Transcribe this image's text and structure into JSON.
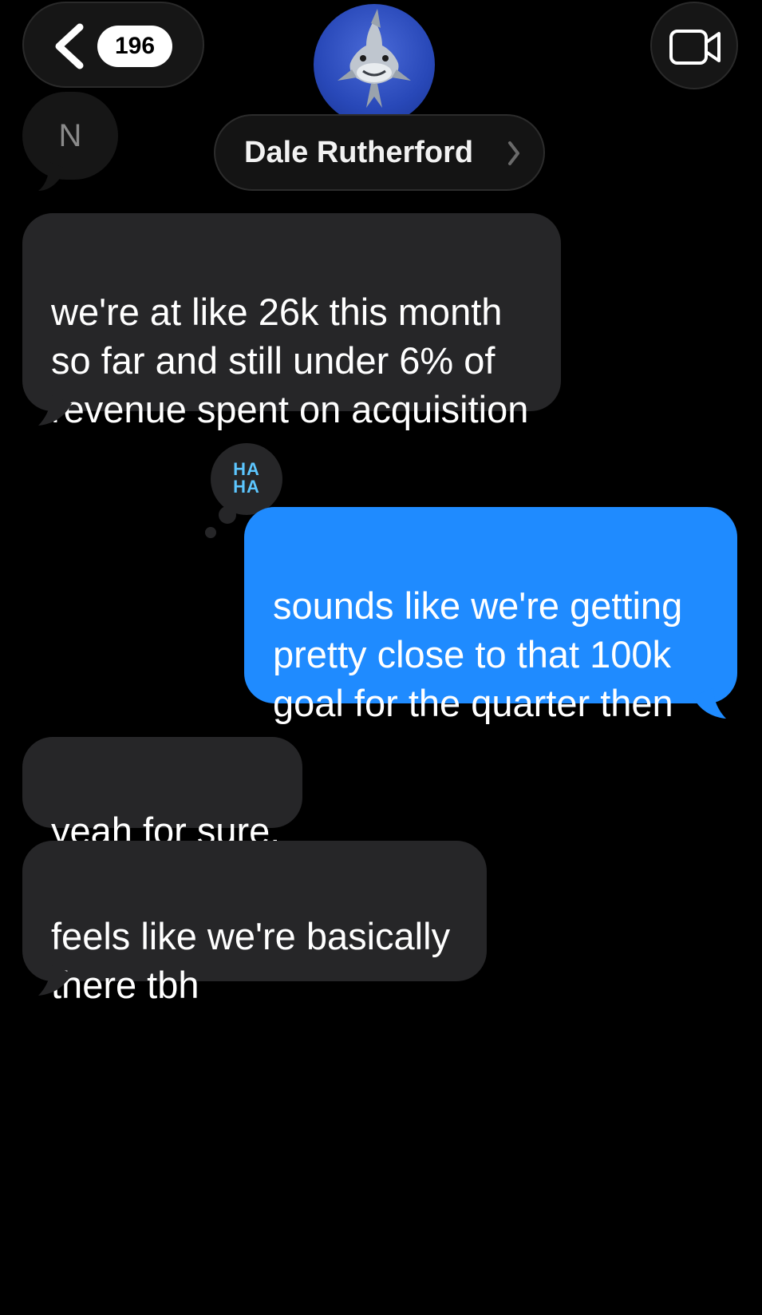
{
  "header": {
    "back_count": "196",
    "contact_name": "Dale Rutherford",
    "initial": "N",
    "avatar_icon": "shark-memoji-icon",
    "video_icon": "video-camera-icon"
  },
  "messages": [
    {
      "direction": "received",
      "text": "we're at like 26k this month\nso far and still under 6% of\nrevenue spent on acquisition"
    },
    {
      "direction": "sent",
      "text": "sounds like we're getting\npretty close to that 100k\ngoal for the quarter then",
      "reaction": "HA\nHA"
    },
    {
      "direction": "received",
      "text": "yeah for sure."
    },
    {
      "direction": "received",
      "text": "feels like we're basically\nthere tbh"
    }
  ],
  "colors": {
    "background": "#000000",
    "received_bubble": "#262628",
    "sent_bubble": "#1f8bff",
    "reaction_text": "#5cc6ff"
  }
}
